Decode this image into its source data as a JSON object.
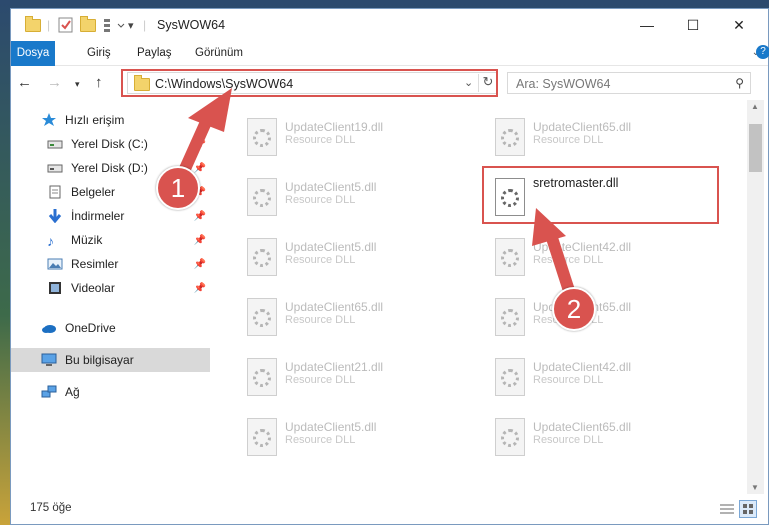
{
  "window": {
    "title": "SysWOW64",
    "controls": [
      "—",
      "☐",
      "✕"
    ]
  },
  "ribbon": {
    "tabs": [
      "Dosya",
      "Giriş",
      "Paylaş",
      "Görünüm"
    ]
  },
  "navigation": {
    "address": "C:\\Windows\\SysWOW64",
    "search_placeholder": "Ara: SysWOW64"
  },
  "sidebar": {
    "items": [
      {
        "label": "Hızlı erişim",
        "icon": "star-icon"
      },
      {
        "label": "Yerel Disk (C:)",
        "icon": "drive-icon"
      },
      {
        "label": "Yerel Disk (D:)",
        "icon": "drive-icon"
      },
      {
        "label": "Belgeler",
        "icon": "documents-icon"
      },
      {
        "label": "İndirmeler",
        "icon": "download-icon"
      },
      {
        "label": "Müzik",
        "icon": "music-icon"
      },
      {
        "label": "Resimler",
        "icon": "pictures-icon"
      },
      {
        "label": "Videolar",
        "icon": "videos-icon"
      },
      {
        "label": "OneDrive",
        "icon": "cloud-icon"
      },
      {
        "label": "Bu bilgisayar",
        "icon": "computer-icon"
      },
      {
        "label": "Ağ",
        "icon": "network-icon"
      }
    ]
  },
  "files": [
    {
      "name": "UpdateClient19.dll",
      "type": "Resource DLL"
    },
    {
      "name": "UpdateClient65.dll",
      "type": "Resource DLL"
    },
    {
      "name": "UpdateClient5.dll",
      "type": "Resource DLL"
    },
    {
      "name": "sretromaster.dll",
      "type": ""
    },
    {
      "name": "UpdateClient5.dll",
      "type": "Resource DLL"
    },
    {
      "name": "UpdateClient42.dll",
      "type": "Resource DLL"
    },
    {
      "name": "UpdateClient65.dll",
      "type": "Resource DLL"
    },
    {
      "name": "UpdateClient65.dll",
      "type": "Resource DLL"
    },
    {
      "name": "UpdateClient21.dll",
      "type": "Resource DLL"
    },
    {
      "name": "UpdateClient42.dll",
      "type": "Resource DLL"
    },
    {
      "name": "UpdateClient5.dll",
      "type": "Resource DLL"
    },
    {
      "name": "UpdateClient65.dll",
      "type": "Resource DLL"
    }
  ],
  "status": {
    "item_count": "175 öğe"
  },
  "annotations": {
    "step1": "1",
    "step2": "2",
    "color": "#d9534f"
  }
}
